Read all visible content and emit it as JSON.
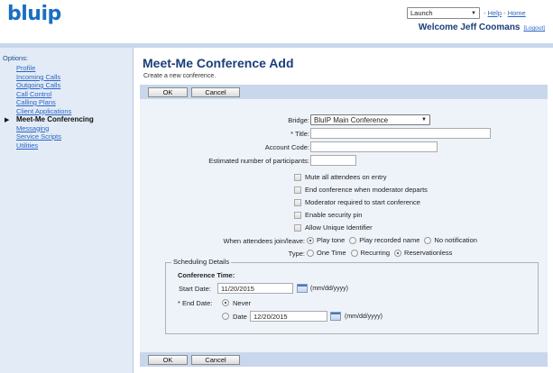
{
  "header": {
    "logo_text": "blu",
    "logo_text_p": "ip",
    "launch_select": "Launch",
    "help_label": "Help",
    "home_label": "Home",
    "link_separator": "-",
    "welcome_text": "Welcome Jeff Coomans",
    "logout_label": "[Logout]"
  },
  "sidebar": {
    "title": "Options:",
    "items": [
      {
        "label": "Profile"
      },
      {
        "label": "Incoming Calls"
      },
      {
        "label": "Outgoing Calls"
      },
      {
        "label": "Call Control"
      },
      {
        "label": "Calling Plans"
      },
      {
        "label": "Client Applications"
      },
      {
        "label": "Meet-Me Conferencing",
        "active": true
      },
      {
        "label": "Messaging"
      },
      {
        "label": "Service Scripts"
      },
      {
        "label": "Utilities"
      }
    ],
    "active_bullet": "▶"
  },
  "main": {
    "title": "Meet-Me Conference Add",
    "subtitle": "Create a new conference.",
    "ok_label": "OK",
    "cancel_label": "Cancel"
  },
  "form": {
    "bridge_label": "Bridge:",
    "bridge_value": "BluIP Main Conference",
    "title_label": "* Title:",
    "title_value": "",
    "account_code_label": "Account Code:",
    "account_code_value": "",
    "participants_label": "Estimated number of participants:",
    "participants_value": "",
    "checkboxes": [
      {
        "label": "Mute all attendees on entry",
        "checked": false
      },
      {
        "label": "End conference when moderator departs",
        "checked": false
      },
      {
        "label": "Moderator required to start conference",
        "checked": false
      },
      {
        "label": "Enable security pin",
        "checked": false
      },
      {
        "label": "Allow Unique Identifier",
        "checked": false
      }
    ],
    "join_leave_label": "When attendees join/leave:",
    "join_leave_options": [
      {
        "label": "Play tone",
        "selected": true
      },
      {
        "label": "Play recorded name",
        "selected": false
      },
      {
        "label": "No notification",
        "selected": false
      }
    ],
    "type_label": "Type:",
    "type_options": [
      {
        "label": "One Time",
        "selected": false
      },
      {
        "label": "Recurring",
        "selected": false
      },
      {
        "label": "Reservationless",
        "selected": true
      }
    ]
  },
  "scheduling": {
    "legend": "Scheduling Details",
    "conference_time_label": "Conference Time:",
    "start_date_label": "Start Date:",
    "start_date_value": "11/20/2015",
    "date_hint": "(mm/dd/yyyy)",
    "end_date_label": "* End Date:",
    "never_label": "Never",
    "never_selected": true,
    "date_label": "Date",
    "date_selected": false,
    "end_date_value": "12/20/2015"
  }
}
